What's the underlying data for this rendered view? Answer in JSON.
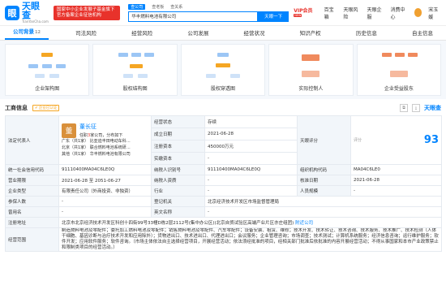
{
  "header": {
    "logo_mark": "眼",
    "logo_big": "天眼查",
    "logo_small": "TianYanCha.com",
    "banner": "国家中小企业发展子基金旗下 官方备案企业征信机构",
    "search_tabs": [
      "查公司",
      "查老板",
      "查关系"
    ],
    "search_value": "华丰燃料电池有限公司",
    "search_button": "天眼一下",
    "vip": "VIP会员",
    "vip_badge": "NEW",
    "menu": [
      "百宝箱",
      "天眼风险",
      "天眼企服",
      "消费中心",
      "宋玉媛"
    ]
  },
  "nav": {
    "tabs": [
      {
        "label": "公司背景",
        "count": "12"
      },
      {
        "label": "司法风险",
        "count": ""
      },
      {
        "label": "经营风险",
        "count": ""
      },
      {
        "label": "公司发展",
        "count": ""
      },
      {
        "label": "经营状况",
        "count": ""
      },
      {
        "label": "知识产权",
        "count": ""
      },
      {
        "label": "历史信息",
        "count": ""
      },
      {
        "label": "自主信息",
        "count": ""
      }
    ]
  },
  "graphs": [
    "企业架构图",
    "股权结构图",
    "股权穿透图",
    "实际控制人",
    "企业受益股东"
  ],
  "section": {
    "title": "工商信息",
    "tag": "企业已认证",
    "logo": "天眼查"
  },
  "rep": {
    "key": "法定代表人",
    "avatar": "董",
    "name": "董长征",
    "role_prefix": "任职",
    "role_count": "3",
    "role_suffix": "家公司，分布如下",
    "rows": [
      {
        "place": "广东（共1家）",
        "company": "比亚迪丰田电动车科…"
      },
      {
        "place": "北京（共1家）",
        "company": "联合燃料电池系统研…"
      },
      {
        "place": "其他（共1家）",
        "company": "华丰燃料电池有限公司"
      }
    ]
  },
  "rows1": [
    {
      "k": "经营状态",
      "v": "存续",
      "k2": "天眼评分",
      "score": "93",
      "score_word": "评分"
    },
    {
      "k": "成立日期",
      "v": "2021-06-28"
    },
    {
      "k": "注册资本",
      "v": "450000万元"
    },
    {
      "k": "实缴资本",
      "v": "-"
    }
  ],
  "grid": [
    [
      "统一社会信用代码",
      "91110400MA04C6LE0Q",
      "纳税人识别号",
      "91110400MA04C6LE0Q",
      "组织机构代码",
      "MA04C6LE0"
    ],
    [
      "营业期限",
      "2021-06-28 至 2051-06-27",
      "纳税人资质",
      "-",
      "核准日期",
      "2021-06-28"
    ],
    [
      "企业类型",
      "有限责任公司（外商投资、非独资）",
      "行业",
      "-",
      "人员规模",
      "-"
    ],
    [
      "参保人数",
      "-",
      "登记机关",
      "北京经济技术开发区市场监督管理局",
      "",
      ""
    ],
    [
      "曾用名",
      "-",
      "英文名称",
      "-",
      "",
      ""
    ]
  ],
  "address": {
    "k": "注册地址",
    "v": "北京市北京经济技术开发区科创十四街99号33幢D栋2层2112号(集中办公区)(北京自贸试验区高端产业片区亦庄组团)",
    "link": "附近公司"
  },
  "scope": {
    "k": "经营范围",
    "v": "制造燃料电池及零配件；委托加工燃料电池及零配件；销售燃料电池及零配件、汽车零配件；设备安装、租赁、维修；技术开发、技术转让、技术咨询、技术服务、技术推广、技术检测（人体干细胞、基因诊断与治疗技术开发和应用除外）；货物进出口、技术进出口、代理进出口；会议服务；企业管理咨询；市场调查；技术测试；计算机系统服务；经济信息咨询；运行维护服务；软件开发；应用软件服务；软件咨询。（市场主体依法自主选择经营项目，开展经营活动；依法须经批准的项目，经相关部门批准后依批准的内容开展经营活动；不得从事国家和本市产业政策禁止和限制类项目的经营活动。）"
  }
}
